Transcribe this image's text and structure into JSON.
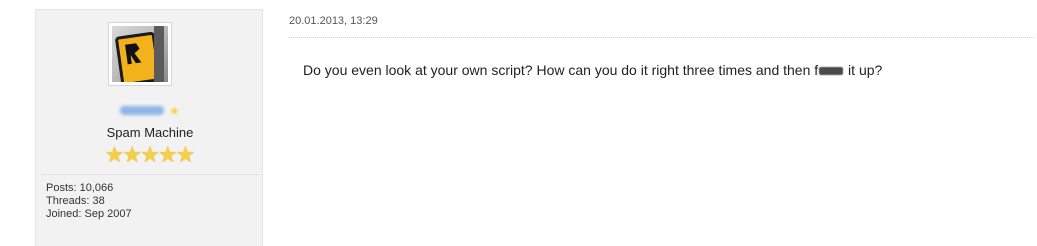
{
  "user": {
    "avatar_icon": "rockstar-logo-avatar",
    "title": "Spam Machine",
    "rating_stars": 5,
    "rating_icon": "star-icon",
    "stats": {
      "posts": "Posts: 10,066",
      "threads": "Threads: 38",
      "joined": "Joined: Sep 2007"
    }
  },
  "post": {
    "date": "20.01.2013, 13:29",
    "text_before": "Do you even look at your own script? How can you do it right three times and then f",
    "text_after": " it up?"
  },
  "colors": {
    "panel_bg": "#f2f2f2",
    "star": "#f5cf45",
    "username_blur": "#8fb6e6"
  }
}
